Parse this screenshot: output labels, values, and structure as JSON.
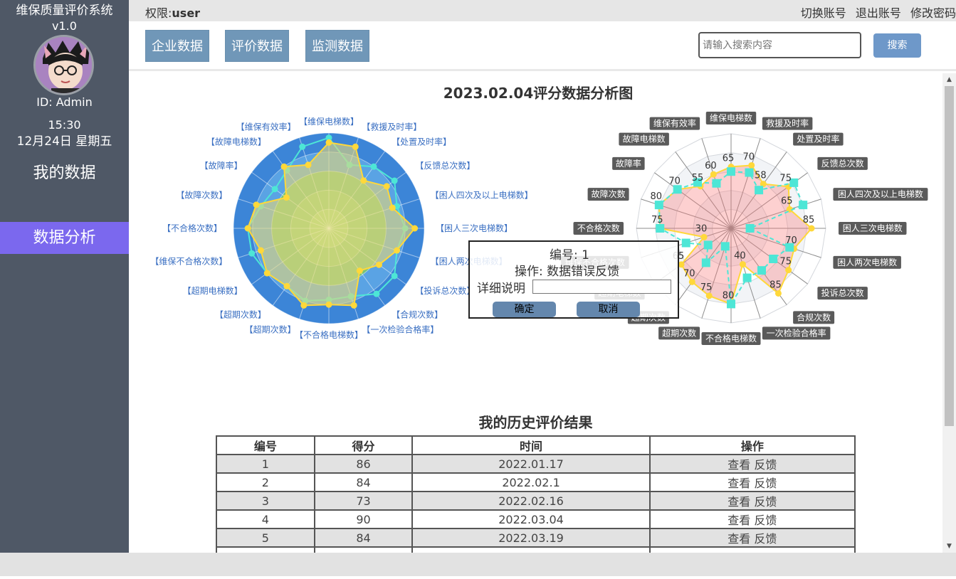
{
  "app": {
    "title": "维保质量评价系统",
    "version": "v1.0"
  },
  "user": {
    "id_label": "ID: Admin",
    "time": "15:30",
    "date": "12月24日 星期五"
  },
  "sidebar": {
    "items": [
      {
        "label": "我的数据"
      },
      {
        "label": "数据分析"
      }
    ]
  },
  "topbar": {
    "perm_label": "权限:",
    "perm_value": "user",
    "links": [
      "切换账号",
      "退出账号",
      "修改密码"
    ]
  },
  "toolbar": {
    "buttons": [
      "企业数据",
      "评价数据",
      "监测数据"
    ],
    "search_placeholder": "请输入搜索内容",
    "search_button": "搜索"
  },
  "colors": {
    "sidebar": "#4f5866",
    "active_nav": "#7b68ee",
    "button": "#7097b8",
    "radar_line": "#ffd83a",
    "radar_cyan": "#4de6d6",
    "radar_fill_right": "#f8a0a0"
  },
  "chart_data": [
    {
      "type": "radar",
      "title": "2023.02.04评分数据分析图",
      "indicators": [
        "维保电梯数",
        "救援及时率",
        "处置及时率",
        "反馈总次数",
        "困人四次及以上电梯数",
        "困人三次电梯数",
        "困人两次电梯数",
        "投诉总次数",
        "合规次数",
        "一次检验合格率",
        "不合格电梯数",
        "超期次数",
        "超期次数",
        "超期电梯数",
        "维保不合格次数",
        "不合格次数",
        "故障次数",
        "故障率",
        "故障电梯数",
        "维保有效率"
      ],
      "series": [
        {
          "values": [
            90,
            90,
            62,
            75,
            70,
            90,
            75,
            65,
            55,
            85,
            80,
            85,
            75,
            80,
            75,
            85,
            80,
            55,
            80,
            70
          ]
        },
        {
          "values": [
            95,
            70,
            80,
            85,
            75,
            80,
            75,
            85,
            85,
            75,
            75,
            80,
            75,
            80,
            85,
            85,
            75,
            70,
            75,
            90
          ]
        }
      ]
    },
    {
      "type": "radar",
      "indicators": [
        "维保电梯数",
        "救援及时率",
        "处置及时率",
        "反馈总次数",
        "困人四次及以上电梯数",
        "困人三次电梯数",
        "困人两次电梯数",
        "投诉总次数",
        "合规次数",
        "一次检验合格率",
        "不合格电梯数",
        "超期次数",
        "超期次数",
        "超期电梯数",
        "维保不合格次数",
        "不合格次数",
        "故障次数",
        "故障率",
        "故障电梯数",
        "维保有效率"
      ],
      "series": [
        {
          "values": [
            65,
            70,
            58,
            75,
            65,
            85,
            70,
            75,
            85,
            40,
            80,
            75,
            70,
            65,
            30,
            75,
            80,
            70,
            55,
            60
          ]
        },
        {
          "values": [
            60,
            62,
            50,
            82,
            80,
            20,
            65,
            55,
            55,
            55,
            80,
            20,
            45,
            30,
            50,
            75,
            80,
            70,
            60,
            50
          ]
        }
      ]
    }
  ],
  "history": {
    "title": "我的历史评价结果",
    "headers": [
      "编号",
      "得分",
      "时间",
      "操作"
    ],
    "view_label": "查看",
    "feedback_label": "反馈",
    "rows": [
      {
        "no": "1",
        "score": "86",
        "time": "2022.01.17"
      },
      {
        "no": "2",
        "score": "84",
        "time": "2022.02.1"
      },
      {
        "no": "3",
        "score": "73",
        "time": "2022.02.16"
      },
      {
        "no": "4",
        "score": "90",
        "time": "2022.03.04"
      },
      {
        "no": "5",
        "score": "84",
        "time": "2022.03.19"
      },
      {
        "no": "",
        "score": "",
        "time": ""
      }
    ]
  },
  "modal": {
    "number": "编号: 1",
    "operation": "操作: 数据错误反馈",
    "detail_label": "详细说明",
    "ok": "确定",
    "cancel": "取消"
  }
}
